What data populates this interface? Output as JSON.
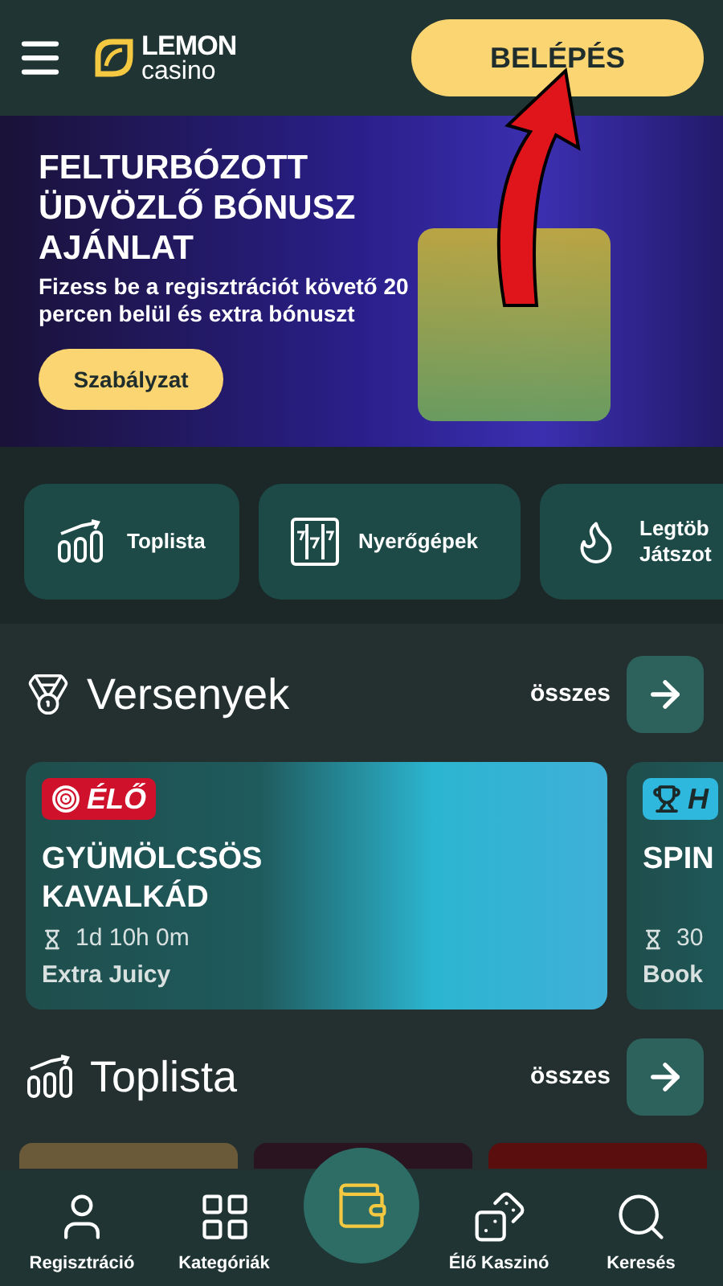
{
  "header": {
    "logo_top": "LEMON",
    "logo_bottom": "casino",
    "login_button": "BELÉPÉS"
  },
  "banner": {
    "title": "FELTURBÓZOTT ÜDVÖZLŐ BÓNUSZ AJÁNLAT",
    "subtitle": "Fizess be a regisztrációt követő 20 percen belül és extra bónuszt",
    "button": "Szabályzat"
  },
  "quick_links": [
    {
      "kind": "chart",
      "lines": [
        "Toplista"
      ]
    },
    {
      "kind": "slots",
      "lines": [
        "Nyerőgépek"
      ]
    },
    {
      "kind": "fire",
      "lines": [
        "Legtöb",
        "Játszot"
      ]
    }
  ],
  "tournaments": {
    "title": "Versenyek",
    "all_link": "összes",
    "cards": [
      {
        "badge": "ÉLŐ",
        "kind": "live",
        "color": "#d0112b",
        "title": "GYÜMÖLCSÖS KAVALKÁD",
        "time": "1d 10h 0m",
        "game": "Extra Juicy"
      },
      {
        "badge": "H",
        "kind": "trophy",
        "color": "#2fb8de",
        "title": "SPIN",
        "time": "30",
        "game": "Book"
      }
    ]
  },
  "toplist": {
    "title": "Toplista",
    "all_link": "összes"
  },
  "bottom_nav": [
    {
      "kind": "user",
      "label": "Regisztráció"
    },
    {
      "kind": "grid",
      "label": "Kategóriák"
    },
    {
      "kind": "wallet"
    },
    {
      "kind": "dice",
      "label": "Élő Kaszinó"
    },
    {
      "kind": "search",
      "label": "Keresés"
    }
  ]
}
